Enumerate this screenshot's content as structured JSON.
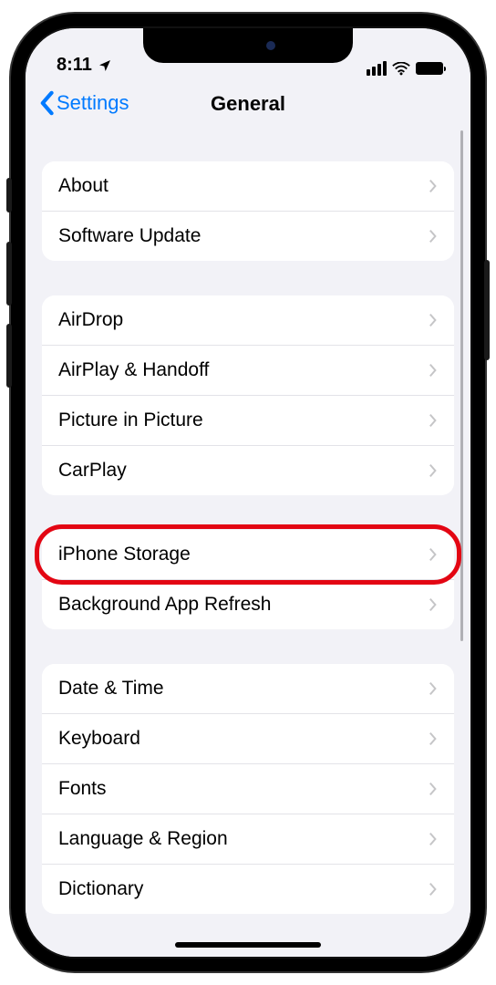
{
  "status": {
    "time": "8:11"
  },
  "nav": {
    "back_label": "Settings",
    "title": "General"
  },
  "groups": [
    {
      "items": [
        {
          "label": "About",
          "name": "row-about"
        },
        {
          "label": "Software Update",
          "name": "row-software-update"
        }
      ]
    },
    {
      "items": [
        {
          "label": "AirDrop",
          "name": "row-airdrop"
        },
        {
          "label": "AirPlay & Handoff",
          "name": "row-airplay-handoff"
        },
        {
          "label": "Picture in Picture",
          "name": "row-picture-in-picture"
        },
        {
          "label": "CarPlay",
          "name": "row-carplay"
        }
      ]
    },
    {
      "items": [
        {
          "label": "iPhone Storage",
          "name": "row-iphone-storage",
          "highlighted": true
        },
        {
          "label": "Background App Refresh",
          "name": "row-background-app-refresh"
        }
      ]
    },
    {
      "items": [
        {
          "label": "Date & Time",
          "name": "row-date-time"
        },
        {
          "label": "Keyboard",
          "name": "row-keyboard"
        },
        {
          "label": "Fonts",
          "name": "row-fonts"
        },
        {
          "label": "Language & Region",
          "name": "row-language-region"
        },
        {
          "label": "Dictionary",
          "name": "row-dictionary"
        }
      ]
    }
  ]
}
